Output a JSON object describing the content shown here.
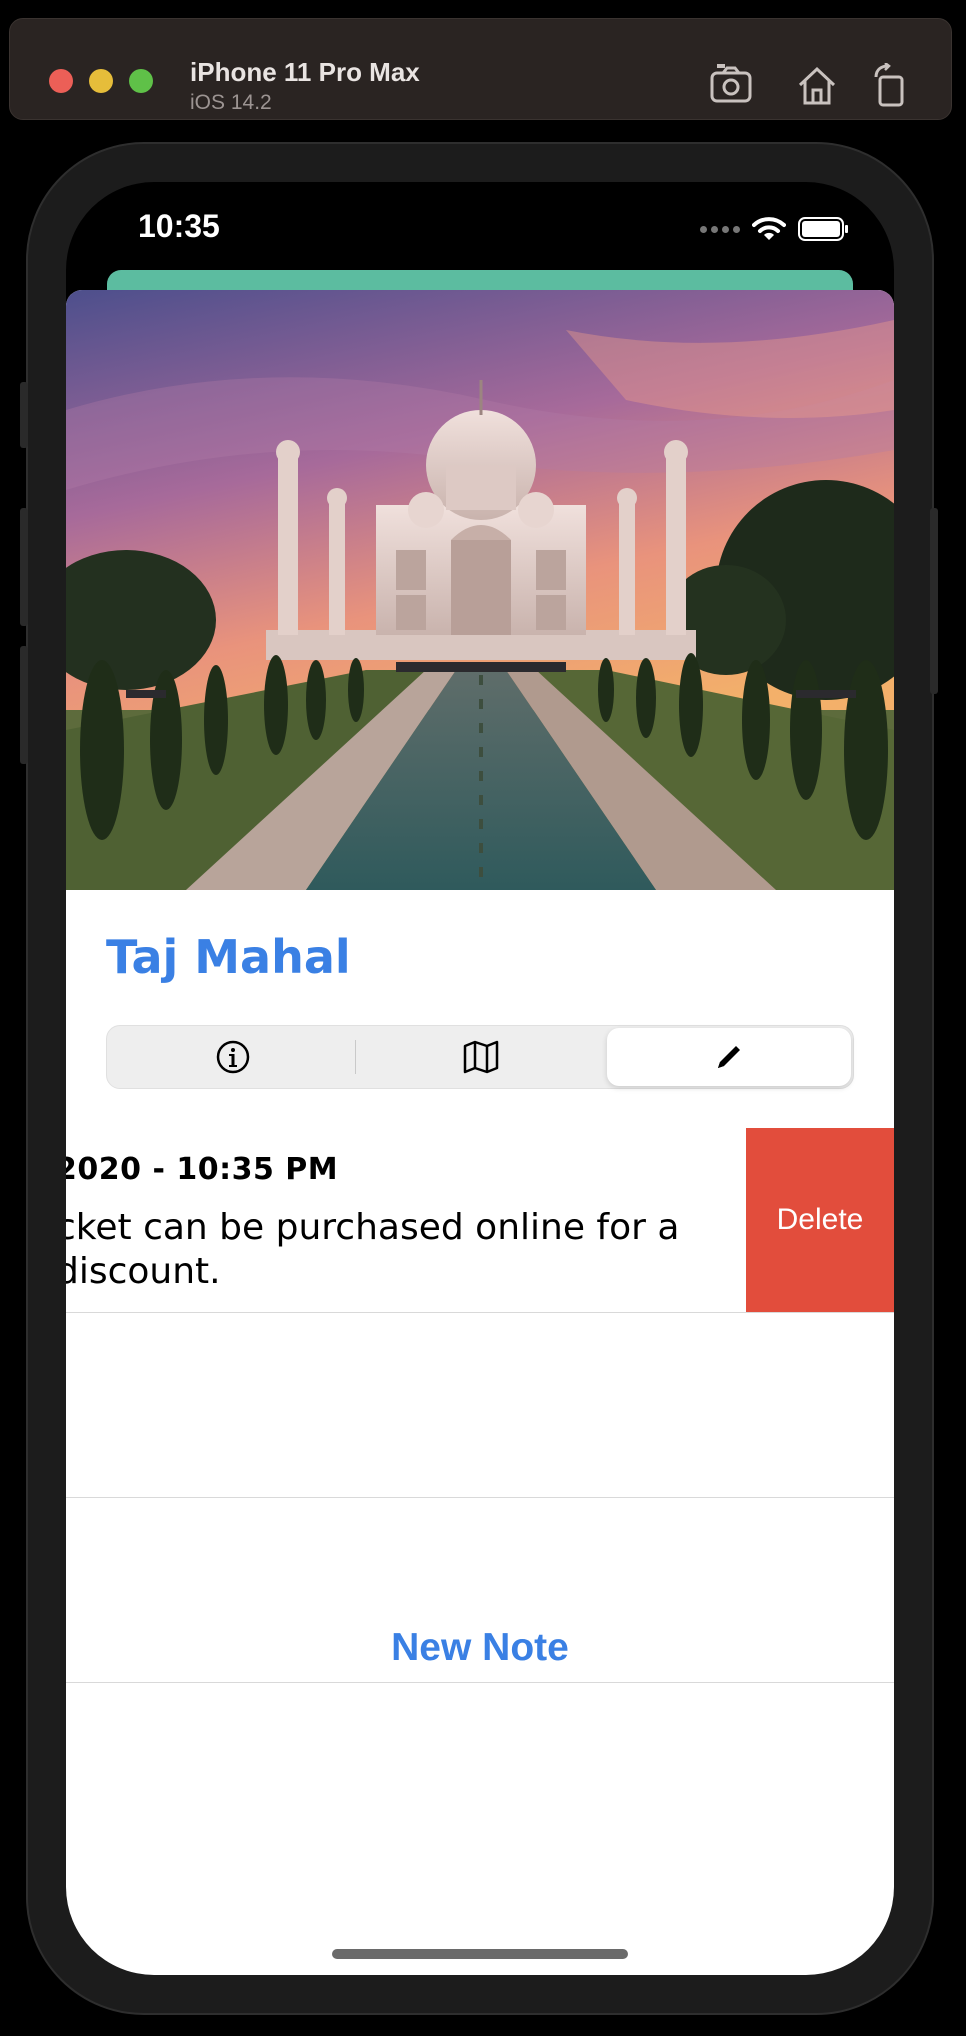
{
  "simulator": {
    "device_name": "iPhone 11 Pro Max",
    "os_version": "iOS 14.2",
    "buttons": [
      "screenshot-icon",
      "home-icon",
      "rotate-icon"
    ]
  },
  "status_bar": {
    "time": "10:35",
    "icons": [
      "signal-dots-icon",
      "wifi-icon",
      "battery-icon"
    ]
  },
  "place": {
    "title": "Taj Mahal",
    "image": "taj-mahal-photo"
  },
  "segmented_control": {
    "segments": [
      {
        "icon": "info-icon",
        "selected": false
      },
      {
        "icon": "map-icon",
        "selected": false
      },
      {
        "icon": "pencil-icon",
        "selected": true
      }
    ]
  },
  "notes": [
    {
      "date": "2020 - 10:35 PM",
      "text": "cket can be purchased online for a discount.",
      "text_line1": "cket can be purchased online for a",
      "text_line2": "discount.",
      "delete_label": "Delete"
    }
  ],
  "actions": {
    "new_note_label": "New Note"
  },
  "colors": {
    "accent": "#3a80e4",
    "delete": "#e24d3c",
    "sheet_peek": "#5cbca0"
  }
}
